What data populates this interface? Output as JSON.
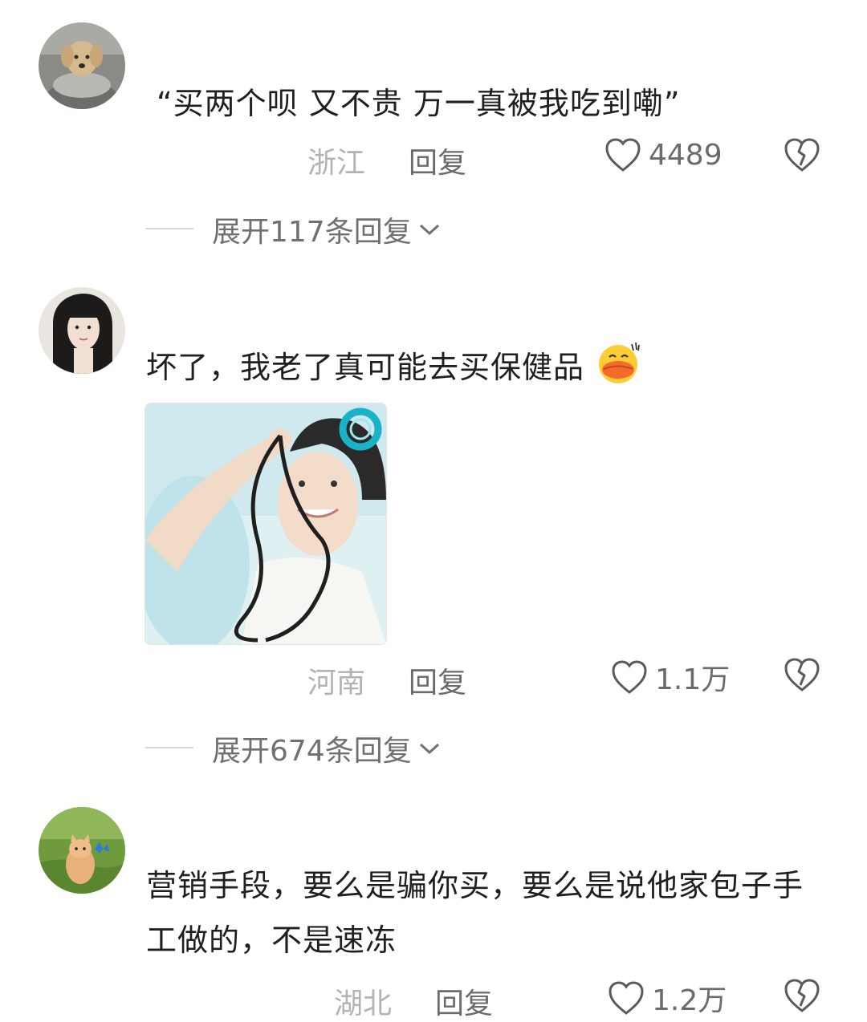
{
  "comments": [
    {
      "text": "“买两个呗 又不贵 万一真被我吃到嘞”",
      "location": "浙江",
      "reply_label": "回复",
      "likes": "4489",
      "expand_label": "展开117条回复"
    },
    {
      "text": "坏了，我老了真可能去买保健品",
      "emoji": "sweat-smile-emoji",
      "location": "河南",
      "reply_label": "回复",
      "likes": "1.1万",
      "expand_label": "展开674条回复"
    },
    {
      "text": "营销手段，要么是骗你买，要么是说他家包子手工做的，不是速冻",
      "location": "湖北",
      "reply_label": "回复",
      "likes": "1.2万"
    }
  ],
  "colors": {
    "text": "#1f1f1f",
    "meta": "#9a9a9a",
    "icon": "#555555"
  },
  "icons": [
    "heart-icon",
    "broken-heart-icon",
    "chevron-down-icon"
  ]
}
